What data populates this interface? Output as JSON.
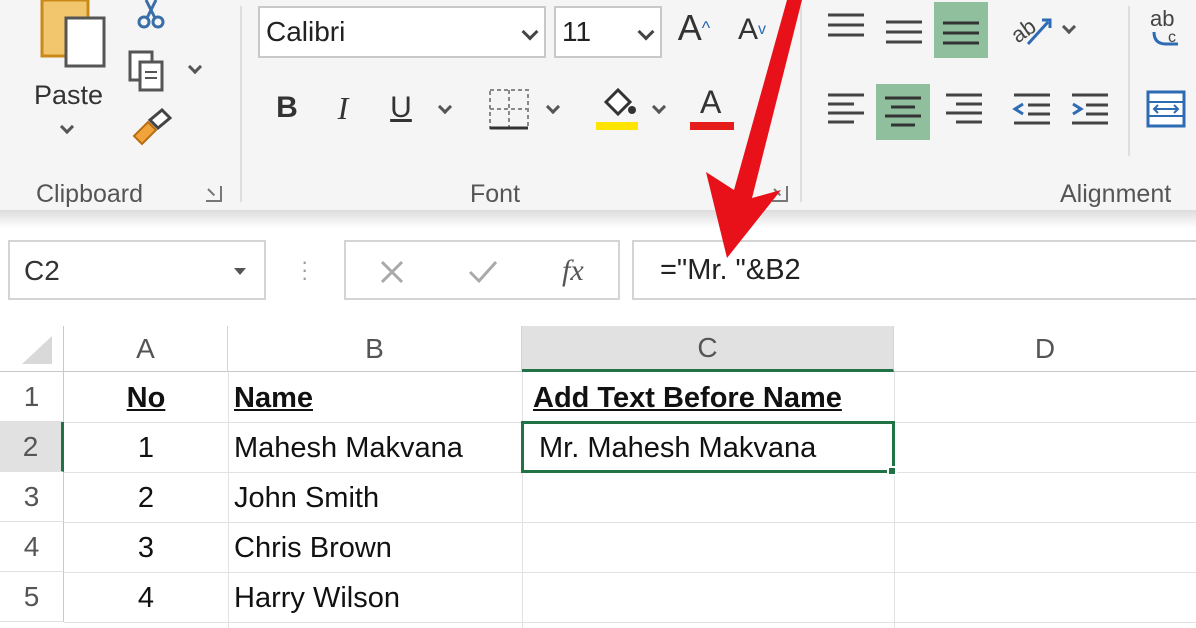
{
  "ribbon": {
    "clipboard": {
      "paste_label": "Paste",
      "group_label": "Clipboard"
    },
    "font": {
      "font_name": "Calibri",
      "font_size": "11",
      "grow_label": "A",
      "shrink_label": "A",
      "bold_label": "B",
      "italic_label": "I",
      "underline_label": "U",
      "font_color_label": "A",
      "group_label": "Font",
      "highlight_color": "#ffe400",
      "font_color": "#e51c1c"
    },
    "alignment": {
      "group_label": "Alignment",
      "wrap_label": "ab",
      "selected_color": "#8fbf9c"
    }
  },
  "formula_bar": {
    "name_box": "C2",
    "formula": "=\"Mr. \"&B2"
  },
  "sheet": {
    "columns": [
      "A",
      "B",
      "C",
      "D"
    ],
    "rows": [
      "1",
      "2",
      "3",
      "4",
      "5"
    ],
    "header": {
      "no": "No",
      "name": "Name",
      "added": "Add Text Before Name"
    },
    "data": [
      {
        "no": "1",
        "name": "Mahesh Makvana",
        "added": "Mr. Mahesh Makvana"
      },
      {
        "no": "2",
        "name": "John Smith",
        "added": ""
      },
      {
        "no": "3",
        "name": "Chris Brown",
        "added": ""
      },
      {
        "no": "4",
        "name": "Harry Wilson",
        "added": ""
      }
    ],
    "selection_color": "#217346",
    "active_header_bg": "#e1e1e1"
  },
  "annotation": {
    "arrow_color": "#e8111a"
  }
}
